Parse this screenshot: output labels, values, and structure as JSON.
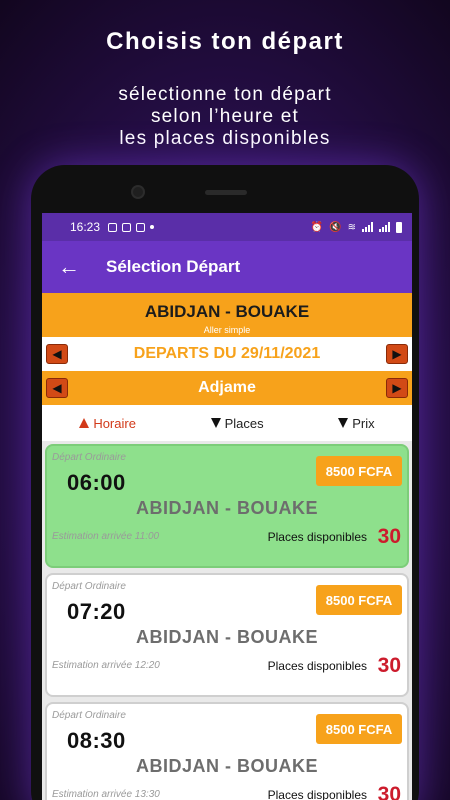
{
  "promo": {
    "title": "Choisis ton départ",
    "subtitle_lines": [
      "sélectionne ton départ",
      "selon l’heure et",
      "les places disponibles"
    ]
  },
  "statusbar": {
    "time": "16:23",
    "left_icons": [
      "image-icon",
      "message-icon",
      "youtube-icon"
    ],
    "right_icons": [
      "alarm-icon",
      "mute-icon",
      "wifi-icon",
      "signal-icon",
      "signal-icon",
      "battery-icon"
    ]
  },
  "appbar": {
    "title": "Sélection Départ",
    "back_icon": "arrow-left-icon"
  },
  "route_bar": {
    "route": "ABIDJAN - BOUAKE",
    "trip_type": "Aller simple"
  },
  "date_nav": {
    "label": "DEPARTS DU 29/11/2021"
  },
  "station_nav": {
    "label": "Adjame"
  },
  "sort": {
    "horaire": "Horaire",
    "places": "Places",
    "prix": "Prix"
  },
  "departures": [
    {
      "kind": "Départ Ordinaire",
      "time": "06:00",
      "route": "ABIDJAN - BOUAKE",
      "price": "8500 FCFA",
      "eta": "Estimation arrivée 11:00",
      "seats_label": "Places disponibles",
      "seats": "30",
      "selected": true
    },
    {
      "kind": "Départ Ordinaire",
      "time": "07:20",
      "route": "ABIDJAN - BOUAKE",
      "price": "8500 FCFA",
      "eta": "Estimation arrivée 12:20",
      "seats_label": "Places disponibles",
      "seats": "30",
      "selected": false
    },
    {
      "kind": "Départ Ordinaire",
      "time": "08:30",
      "route": "ABIDJAN - BOUAKE",
      "price": "8500 FCFA",
      "eta": "Estimation arrivée 13:30",
      "seats_label": "Places disponibles",
      "seats": "30",
      "selected": false
    }
  ],
  "colors": {
    "purple": "#6a35c4",
    "orange": "#f7a21b",
    "green": "#8ee08c",
    "red": "#cc1b2c"
  }
}
